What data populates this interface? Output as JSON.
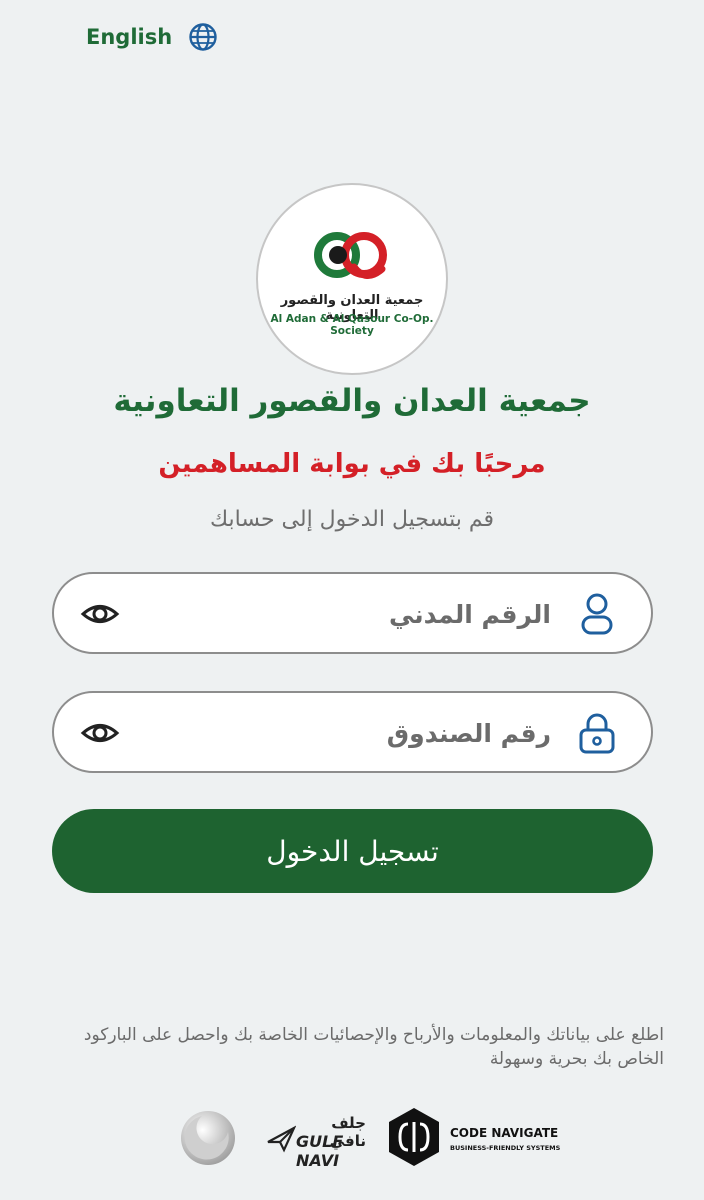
{
  "language_switch": {
    "label": "English",
    "icon": "globe-icon"
  },
  "logo": {
    "arabic_text": "جمعية العدان والقصور التعاونية",
    "english_text": "Al Adan & Al Qasour Co-Op. Society"
  },
  "title": "جمعية العدان والقصور التعاونية",
  "welcome": "مرحبًا بك في بوابة المساهمين",
  "subtitle": "قم بتسجيل الدخول إلى حسابك",
  "form": {
    "civil_id": {
      "placeholder": "الرقم المدني",
      "value": "",
      "icon": "user-icon"
    },
    "box_number": {
      "placeholder": "رقم الصندوق",
      "value": "",
      "icon": "lock-icon"
    },
    "login_label": "تسجيل الدخول"
  },
  "info_text": "اطلع على بياناتك والمعلومات والأرباح والإحصائيات الخاصة بك  واحصل على الباركود الخاص بك بحرية وسهولة",
  "footer": {
    "gulf_navi_arabic": "جلف نافي",
    "gulf_navi_english": "GULF NAVI",
    "code_navigate_title": "CODE NAVIGATE",
    "code_navigate_tagline": "BUSINESS-FRIENDLY SYSTEMS"
  },
  "colors": {
    "brand_green": "#1f6b37",
    "button_green": "#1e6330",
    "accent_red": "#d42027",
    "icon_blue": "#1f5f9e",
    "background": "#eef1f2"
  }
}
